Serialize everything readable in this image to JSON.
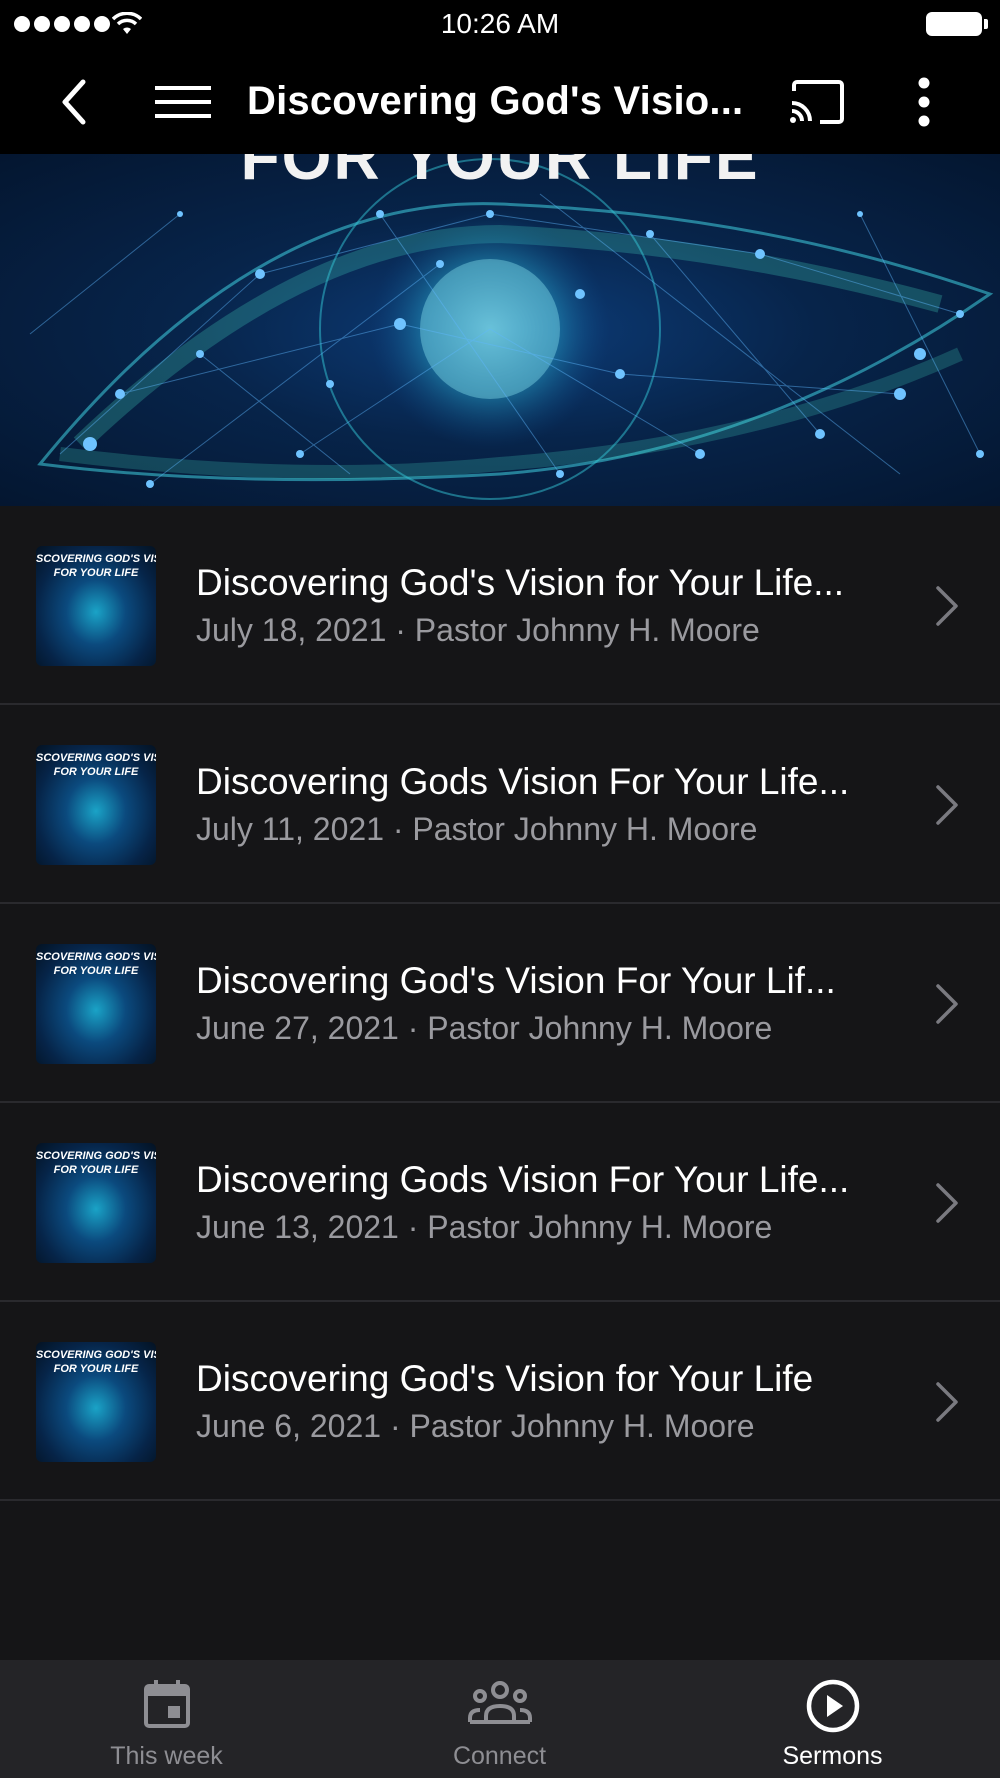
{
  "status_bar": {
    "time": "10:26 AM"
  },
  "nav": {
    "title": "Discovering God's Visio..."
  },
  "hero": {
    "text": "FOR YOUR LIFE"
  },
  "thumbnail": {
    "text_line1": "SCOVERING GOD'S VISIC",
    "text_line2": "FOR YOUR LIFE"
  },
  "sermons": [
    {
      "title": "Discovering God's Vision for Your Life...",
      "subtitle": "July 18, 2021 · Pastor Johnny H. Moore"
    },
    {
      "title": "Discovering Gods Vision For Your Life...",
      "subtitle": "July 11, 2021 · Pastor Johnny H. Moore"
    },
    {
      "title": "Discovering God's Vision For Your Lif...",
      "subtitle": "June 27, 2021 · Pastor Johnny H. Moore"
    },
    {
      "title": "Discovering Gods Vision For Your Life...",
      "subtitle": "June 13, 2021 · Pastor Johnny H. Moore"
    },
    {
      "title": "Discovering God's Vision for Your Life",
      "subtitle": "June 6, 2021 · Pastor Johnny H. Moore"
    }
  ],
  "tabs": [
    {
      "label": "This week",
      "icon": "calendar-icon"
    },
    {
      "label": "Connect",
      "icon": "people-icon"
    },
    {
      "label": "Sermons",
      "icon": "play-circle-icon",
      "active": true
    }
  ],
  "colors": {
    "background": "#151517",
    "bar": "#000000",
    "tab_bar": "#242427",
    "secondary_text": "#9a9a9f",
    "inactive_tab": "#8e8e93"
  }
}
